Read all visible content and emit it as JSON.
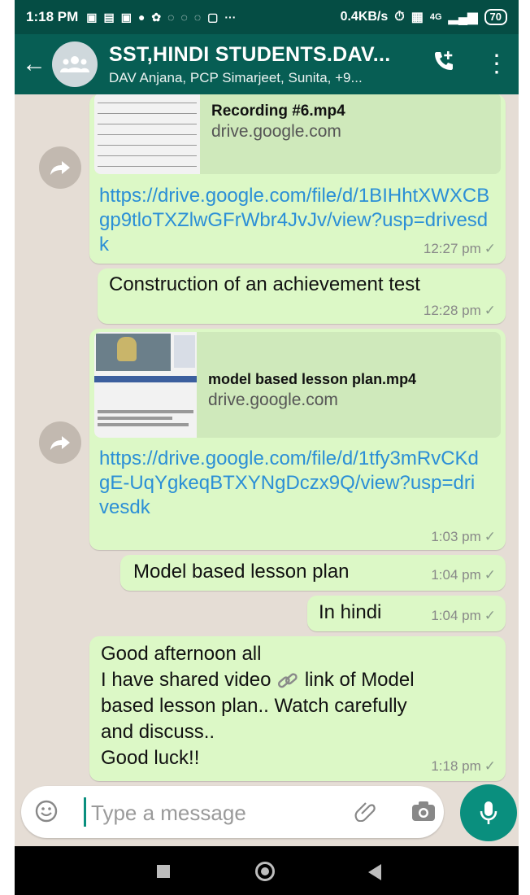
{
  "status_bar": {
    "time": "1:18 PM",
    "network_speed": "0.4KB/s",
    "signal": "4G",
    "battery": "70"
  },
  "header": {
    "title": "SST,HINDI STUDENTS.DAV...",
    "subtitle": "DAV Anjana, PCP Simarjeet, Sunita, +9..."
  },
  "messages": [
    {
      "preview_title": "Recording #6.mp4",
      "preview_domain": "drive.google.com",
      "link": "https://drive.google.com/file/d/1BIHhtXWXCBgp9tloTXZlwGFrWbr4JvJv/view?usp=drivesdk",
      "time": "12:27 pm"
    },
    {
      "text": "Construction of an achievement test",
      "time": "12:28 pm"
    },
    {
      "preview_title": "model based lesson plan.mp4",
      "preview_domain": "drive.google.com",
      "link": "https://drive.google.com/file/d/1tfy3mRvCKdgE-UqYgkeqBTXYNgDczx9Q/view?usp=drivesdk",
      "time": "1:03 pm"
    },
    {
      "text": "Model based lesson plan",
      "time": "1:04 pm"
    },
    {
      "text": "In hindi",
      "time": "1:04 pm"
    },
    {
      "lines": [
        "Good afternoon all",
        "I have shared video",
        "link of Model",
        "based lesson plan.. Watch carefully",
        "and discuss..",
        "Good luck!!"
      ],
      "time": "1:18 pm"
    }
  ],
  "composer": {
    "placeholder": "Type a message"
  },
  "icons": {
    "back": "arrow-left-icon",
    "avatar": "group-icon",
    "call": "add-call-icon",
    "menu": "more-vertical-icon",
    "forward": "forward-icon",
    "emoji": "emoji-icon",
    "attach": "paperclip-icon",
    "camera": "camera-icon",
    "mic": "microphone-icon",
    "link": "chain-link-icon"
  },
  "colors": {
    "header": "#075e54",
    "status_bar": "#054d44",
    "outgoing_bubble": "#dcf8c6",
    "chat_background": "#e5ddd5",
    "link": "#2b8fd6",
    "accent": "#0a8f7e"
  }
}
